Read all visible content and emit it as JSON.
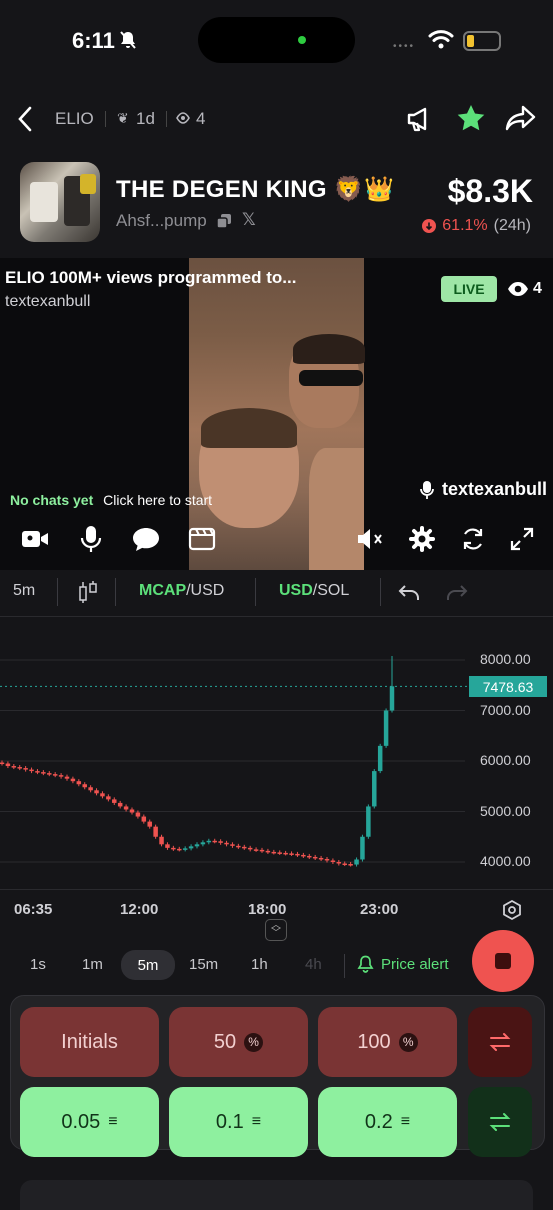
{
  "status": {
    "time": "6:11"
  },
  "header": {
    "token_symbol": "ELIO",
    "age": "1d",
    "holders_count": "4",
    "title": "THE DEGEN KING 🦁👑",
    "address": "Ahsf...pump",
    "price": "$8.3K",
    "change": "61.1%",
    "change_period": "(24h)",
    "colors": {
      "favorite": "#5ce07a",
      "negative": "#ef5350"
    }
  },
  "stream": {
    "title": "ELIO 100M+ views programmed to...",
    "username": "textexanbull",
    "live_label": "LIVE",
    "viewers": "4",
    "chat_status": "No chats yet",
    "chat_cta": "Click here to start",
    "host": "textexanbull"
  },
  "toolbar": {
    "interval": "5m",
    "mcap_label": "MCAP",
    "mcap_suffix": "/USD",
    "usd_label": "USD",
    "usd_suffix": "/SOL"
  },
  "chart_data": {
    "type": "candlestick",
    "y_ticks": [
      "8000.00",
      "7000.00",
      "6000.00",
      "5000.00",
      "4000.00"
    ],
    "current_price_label": "7478.63",
    "x_ticks": [
      "06:35",
      "12:00",
      "18:00",
      "23:00"
    ],
    "ylim": [
      3500,
      8500
    ],
    "colors": {
      "up": "#26a69a",
      "down": "#ef5350"
    },
    "close_series": [
      5950,
      5900,
      5880,
      5860,
      5830,
      5800,
      5780,
      5760,
      5740,
      5720,
      5690,
      5650,
      5600,
      5540,
      5480,
      5420,
      5360,
      5300,
      5240,
      5170,
      5100,
      5040,
      4980,
      4900,
      4800,
      4700,
      4500,
      4350,
      4280,
      4260,
      4250,
      4270,
      4310,
      4350,
      4390,
      4420,
      4410,
      4380,
      4350,
      4320,
      4300,
      4280,
      4250,
      4240,
      4220,
      4200,
      4190,
      4180,
      4170,
      4160,
      4140,
      4120,
      4100,
      4080,
      4060,
      4030,
      4000,
      3970,
      3960,
      3950,
      4050,
      4500,
      5100,
      5800,
      6300,
      7000,
      7478.63
    ]
  },
  "timeframes": {
    "items": [
      "1s",
      "1m",
      "5m",
      "15m",
      "1h",
      "4h"
    ],
    "active": "5m",
    "price_alert": "Price alert"
  },
  "trade": {
    "sell_buttons": [
      "Initials",
      "50",
      "100"
    ],
    "buy_buttons": [
      "0.05",
      "0.1",
      "0.2"
    ]
  }
}
